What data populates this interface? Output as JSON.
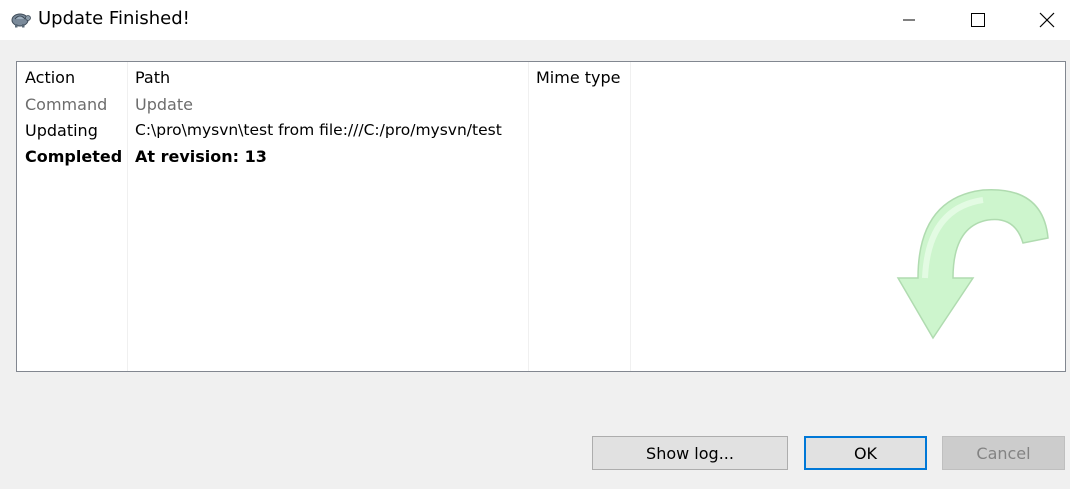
{
  "window": {
    "title": "Update Finished!",
    "icons": {
      "app": "tortoise-icon",
      "minimize": "minimize-icon",
      "maximize": "maximize-icon",
      "close": "close-icon"
    }
  },
  "list": {
    "columns": [
      "Action",
      "Path",
      "Mime type"
    ],
    "rows": [
      {
        "action": "Command",
        "path": "Update",
        "mime": "",
        "style": "gray"
      },
      {
        "action": "Updating",
        "path": "C:\\pro\\mysvn\\test from file:///C:/pro/mysvn/test",
        "mime": "",
        "style": "normal"
      },
      {
        "action": "Completed",
        "path": "At revision: 13",
        "mime": "",
        "style": "bold"
      }
    ],
    "background_icon": "update-arrow-icon"
  },
  "buttons": {
    "show_log": "Show log...",
    "ok": "OK",
    "cancel": "Cancel"
  },
  "colors": {
    "accent": "#0078d7",
    "arrow": "#c8f5c8"
  }
}
